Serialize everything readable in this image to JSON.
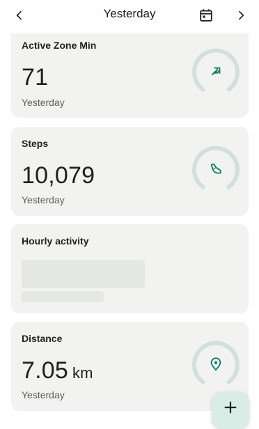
{
  "header": {
    "title": "Yesterday",
    "back_icon": "chevron-left-icon",
    "calendar_icon": "calendar-icon",
    "forward_icon": "chevron-right-icon"
  },
  "cards": {
    "active_zone": {
      "label": "Active Zone Min",
      "value": "71",
      "sub": "Yesterday",
      "icon": "arrows-icon"
    },
    "steps": {
      "label": "Steps",
      "value": "10,079",
      "sub": "Yesterday",
      "icon": "shoe-icon"
    },
    "hourly": {
      "label": "Hourly activity"
    },
    "distance": {
      "label": "Distance",
      "value": "7.05",
      "unit": "km",
      "sub": "Yesterday",
      "icon": "location-pin-icon"
    }
  },
  "fab": {
    "icon": "plus-icon"
  },
  "colors": {
    "accent": "#00806a",
    "ring": "#cfe1dc",
    "card_bg": "#f2f3f0"
  }
}
